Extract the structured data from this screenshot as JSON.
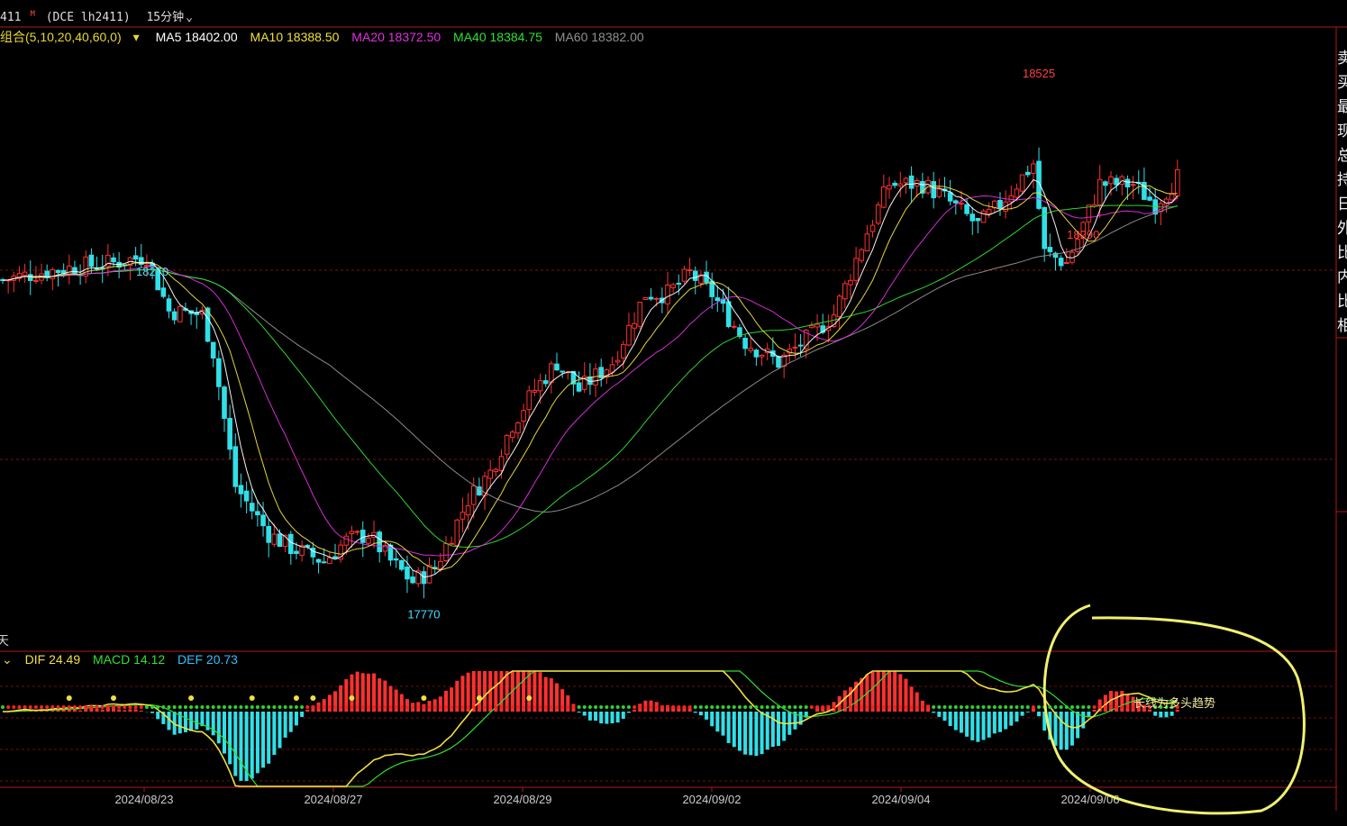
{
  "header": {
    "symbol_fragment": "411",
    "exchange": "(DCE lh2411)",
    "period": "15分钟",
    "period_arrow": "⌄",
    "badge": "M"
  },
  "ma_legend": {
    "group": "组合(5,10,20,40,60,0)",
    "group_arrow": "▾",
    "items": [
      {
        "label": "MA5 18402.00",
        "color": "#ffffff"
      },
      {
        "label": "MA10 18388.50",
        "color": "#f0e040"
      },
      {
        "label": "MA20 18372.50",
        "color": "#e030e0"
      },
      {
        "label": "MA40 18384.75",
        "color": "#30e030"
      },
      {
        "label": "MA60 18382.00",
        "color": "#909090"
      }
    ]
  },
  "macd_legend": {
    "arrow": "⌄",
    "dif": "DIF 24.49",
    "macd": "MACD 14.12",
    "def": "DEF 20.73",
    "dif_color": "#f0e040",
    "macd_color": "#30e030",
    "def_color": "#30c0ff"
  },
  "annotation_text": "长线为多头趋势",
  "side_fragment_label": "天",
  "right_panel_chars": [
    "卖",
    "买",
    "最",
    "现",
    "总",
    "持",
    "日",
    "外",
    "比",
    "内",
    "比",
    "相"
  ],
  "chart_data": {
    "type": "candlestick",
    "title": "",
    "yrange": [
      17700,
      18580
    ],
    "price_labels": [
      {
        "value": 18290,
        "text": "18290",
        "color": "#ff4040"
      },
      {
        "value": 18525,
        "text": "18525",
        "color": "#ff4040"
      },
      {
        "value": 17770,
        "text": "17770",
        "color": "#40e0ff"
      },
      {
        "value": 18270,
        "text": "18270",
        "color": "#40e0ff"
      }
    ],
    "x_ticks": [
      "2024/08/23",
      "2024/08/27",
      "2024/08/29",
      "2024/09/02",
      "2024/09/04",
      "2024/09/06"
    ],
    "close_anchors": [
      [
        0,
        18240
      ],
      [
        6,
        18250
      ],
      [
        14,
        18260
      ],
      [
        20,
        18265
      ],
      [
        26,
        18275
      ],
      [
        30,
        18195
      ],
      [
        36,
        18190
      ],
      [
        38,
        18135
      ],
      [
        42,
        17940
      ],
      [
        48,
        17870
      ],
      [
        52,
        17850
      ],
      [
        58,
        17830
      ],
      [
        62,
        17860
      ],
      [
        66,
        17870
      ],
      [
        70,
        17830
      ],
      [
        74,
        17800
      ],
      [
        78,
        17820
      ],
      [
        84,
        17920
      ],
      [
        88,
        17960
      ],
      [
        92,
        18030
      ],
      [
        96,
        18080
      ],
      [
        100,
        18120
      ],
      [
        104,
        18080
      ],
      [
        110,
        18120
      ],
      [
        116,
        18220
      ],
      [
        120,
        18220
      ],
      [
        124,
        18250
      ],
      [
        128,
        18220
      ],
      [
        134,
        18150
      ],
      [
        140,
        18120
      ],
      [
        146,
        18160
      ],
      [
        150,
        18190
      ],
      [
        156,
        18310
      ],
      [
        160,
        18380
      ],
      [
        166,
        18380
      ],
      [
        170,
        18360
      ],
      [
        176,
        18320
      ],
      [
        180,
        18350
      ],
      [
        186,
        18410
      ],
      [
        188,
        18280
      ],
      [
        192,
        18265
      ],
      [
        194,
        18300
      ],
      [
        198,
        18380
      ],
      [
        204,
        18380
      ],
      [
        208,
        18350
      ],
      [
        212,
        18390
      ]
    ],
    "colors": {
      "up": "#ff3030",
      "down": "#30e0e8",
      "ma5": "#ffffff",
      "ma10": "#f0e040",
      "ma20": "#e030e0",
      "ma40": "#30e030",
      "ma60": "#909090"
    },
    "macd_series": {
      "dif_name": "DIF",
      "def_name": "DEF",
      "macd_name": "MACD"
    }
  }
}
